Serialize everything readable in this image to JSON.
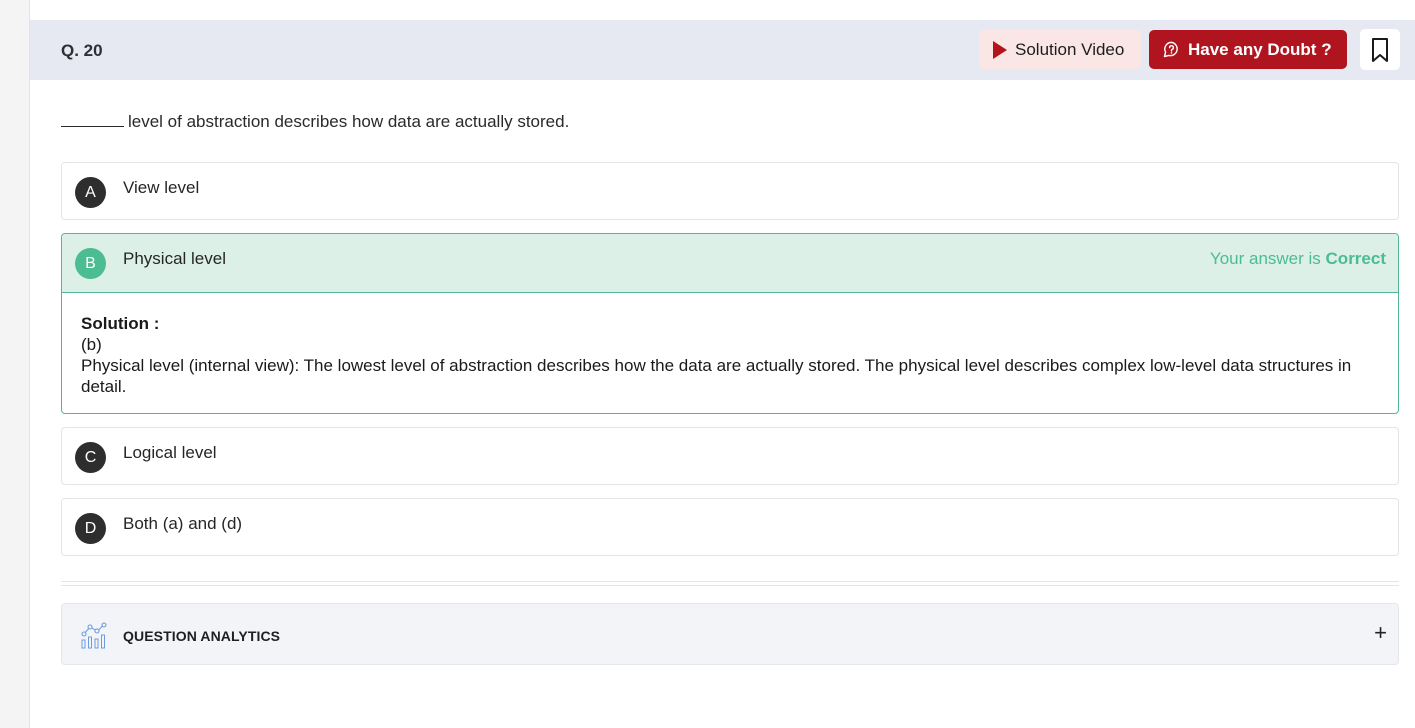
{
  "question": {
    "number_label": "Q. 20",
    "text": "level of abstraction describes how data are actually stored."
  },
  "header_buttons": {
    "solution_video": "Solution Video",
    "have_doubt": "Have any Doubt ?"
  },
  "options": [
    {
      "letter": "A",
      "text": "View level"
    },
    {
      "letter": "B",
      "text": "Physical level"
    },
    {
      "letter": "C",
      "text": "Logical level"
    },
    {
      "letter": "D",
      "text": "Both (a) and (d)"
    }
  ],
  "result": {
    "prefix": "Your answer is",
    "status": "Correct"
  },
  "solution": {
    "title": "Solution :",
    "answer": "(b)",
    "explanation": "Physical level (internal view): The lowest level of abstraction describes how the data are actually stored. The physical level describes complex low-level data structures in detail."
  },
  "analytics": {
    "title": "QUESTION ANALYTICS",
    "toggle": "+"
  },
  "colors": {
    "header_bg": "#e6e9f2",
    "doubt_button": "#b0151f",
    "video_button_bg": "#fbe6e6",
    "correct_green": "#4cbc92",
    "correct_bg": "#dcf0e8"
  },
  "icons": {
    "play": "play-icon",
    "doubt": "question-bubble-icon",
    "bookmark": "bookmark-icon",
    "analytics": "analytics-chart-icon",
    "expand": "plus-icon"
  }
}
